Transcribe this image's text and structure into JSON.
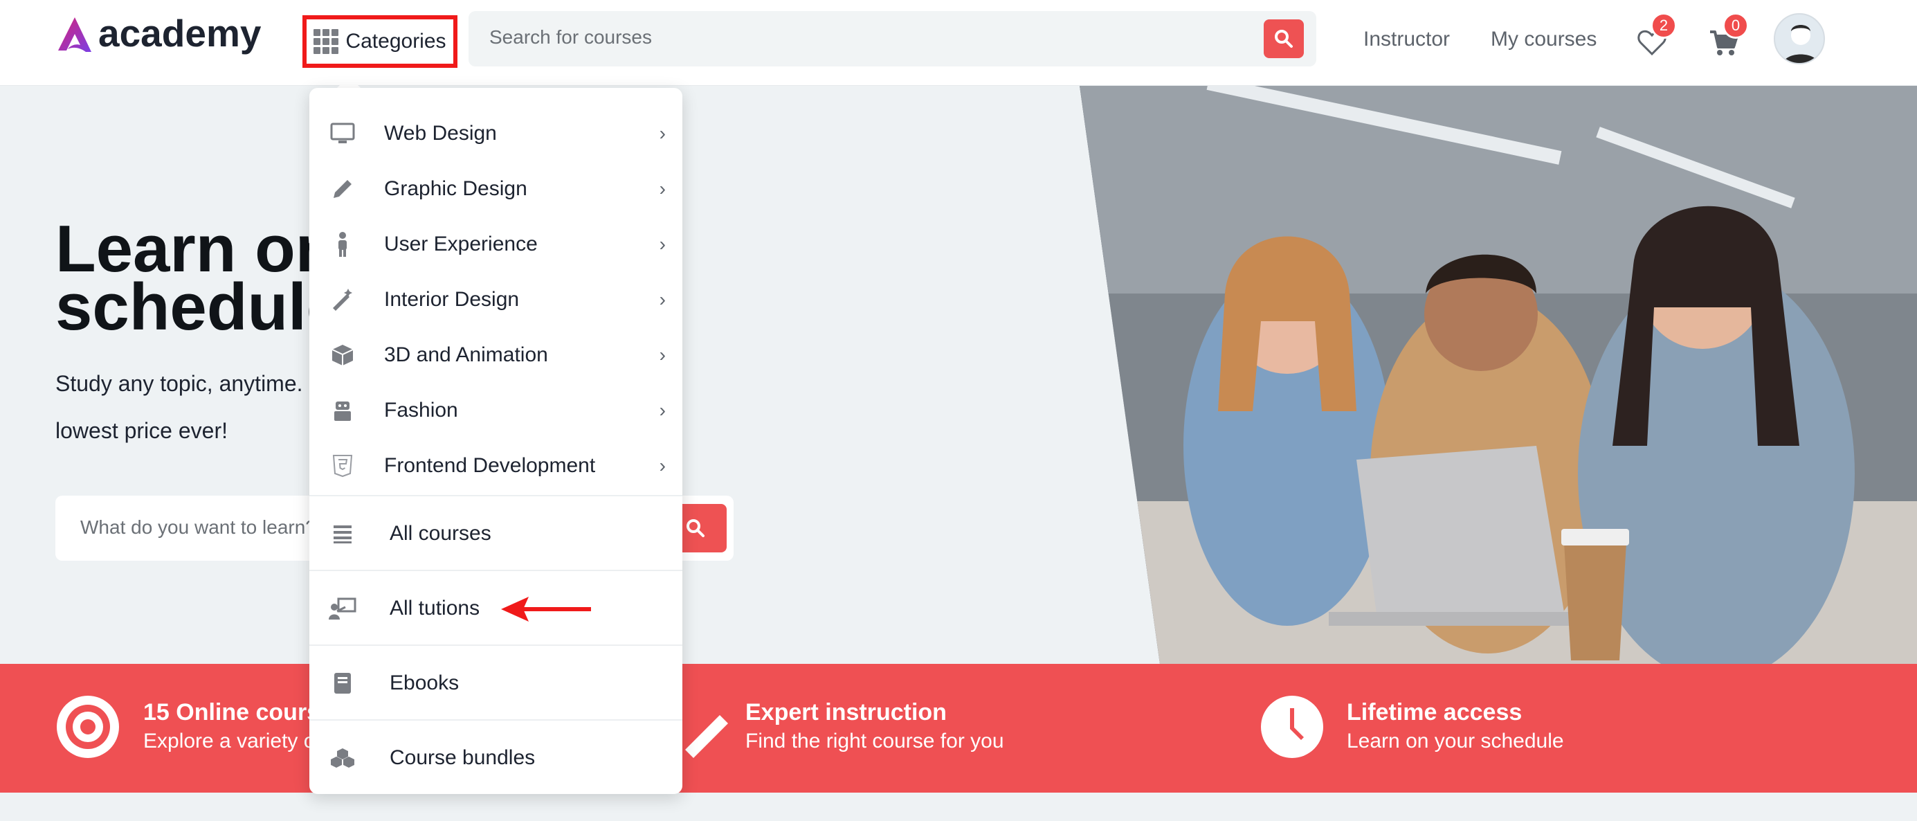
{
  "header": {
    "logo_text": "academy",
    "categories_label": "Categories",
    "search_placeholder": "Search for courses",
    "nav_instructor": "Instructor",
    "nav_my_courses": "My courses",
    "wishlist_count": "2",
    "cart_count": "0"
  },
  "hero": {
    "title_line1": "Learn on your",
    "title_line2": "schedule",
    "subtitle": "Study any topic, anytime. Explore thousands of courses for the lowest price ever!",
    "search_placeholder": "What do you want to learn?"
  },
  "features": [
    {
      "title": "15 Online courses",
      "subtitle": "Explore a variety of fresh topics"
    },
    {
      "title": "Expert instruction",
      "subtitle": "Find the right course for you"
    },
    {
      "title": "Lifetime access",
      "subtitle": "Learn on your schedule"
    }
  ],
  "dropdown": {
    "categories": [
      {
        "label": "Web Design",
        "icon": "monitor-icon"
      },
      {
        "label": "Graphic Design",
        "icon": "pencil-icon"
      },
      {
        "label": "User Experience",
        "icon": "person-icon"
      },
      {
        "label": "Interior Design",
        "icon": "magic-wand-icon"
      },
      {
        "label": "3D and Animation",
        "icon": "cube-icon"
      },
      {
        "label": "Fashion",
        "icon": "robot-icon"
      },
      {
        "label": "Frontend Development",
        "icon": "html5-icon"
      }
    ],
    "extra": [
      {
        "label": "All courses",
        "icon": "list-icon"
      },
      {
        "label": "All tutions",
        "icon": "teacher-board-icon"
      },
      {
        "label": "Ebooks",
        "icon": "book-icon"
      },
      {
        "label": "Course bundles",
        "icon": "cubes-icon"
      }
    ]
  },
  "colors": {
    "accent": "#ee5253",
    "highlight_border": "#f01a1a",
    "band": "#ef5053"
  }
}
